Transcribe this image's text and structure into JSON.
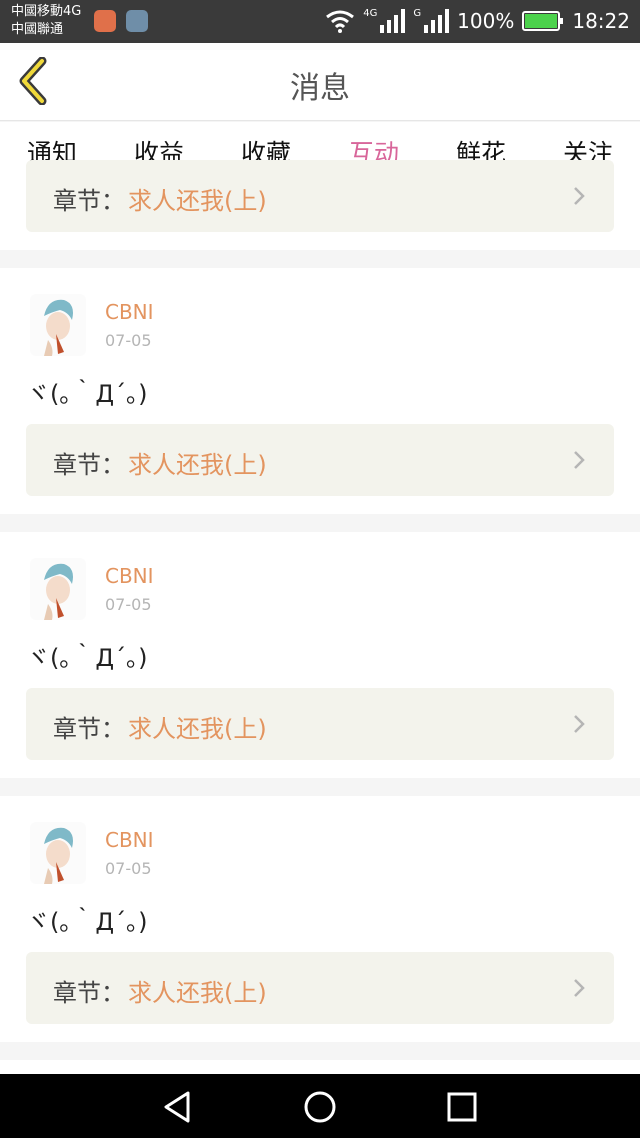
{
  "status_bar": {
    "carrier1": "中國移動4G",
    "carrier2": "中國聯通",
    "net_4g": "4G",
    "net_g": "G",
    "battery": "100%",
    "time": "18:22",
    "battery_color": "#4cd24c"
  },
  "header": {
    "title": "消息",
    "back_icon": "chevron-left-icon"
  },
  "tabs": [
    {
      "label": "通知",
      "active": false
    },
    {
      "label": "收益",
      "active": false
    },
    {
      "label": "收藏",
      "active": false
    },
    {
      "label": "互动",
      "active": true
    },
    {
      "label": "鲜花",
      "active": false
    },
    {
      "label": "关注",
      "active": false
    }
  ],
  "accent_color": "#d8669a",
  "name_color": "#e3945f",
  "partial_card": {
    "chapter_label": "章节：",
    "chapter_value": "求人还我(上)"
  },
  "cards": [
    {
      "username": "CBNI",
      "date": "07-05",
      "message": "ヾ(｡｀Д´｡)",
      "chapter_label": "章节：",
      "chapter_value": "求人还我(上)"
    },
    {
      "username": "CBNI",
      "date": "07-05",
      "message": "ヾ(｡｀Д´｡)",
      "chapter_label": "章节：",
      "chapter_value": "求人还我(上)"
    },
    {
      "username": "CBNI",
      "date": "07-05",
      "message": "ヾ(｡｀Д´｡)",
      "chapter_label": "章节：",
      "chapter_value": "求人还我(上)"
    }
  ],
  "nav_bar": {
    "back": "triangle-back-icon",
    "home": "circle-home-icon",
    "recents": "square-recents-icon"
  }
}
